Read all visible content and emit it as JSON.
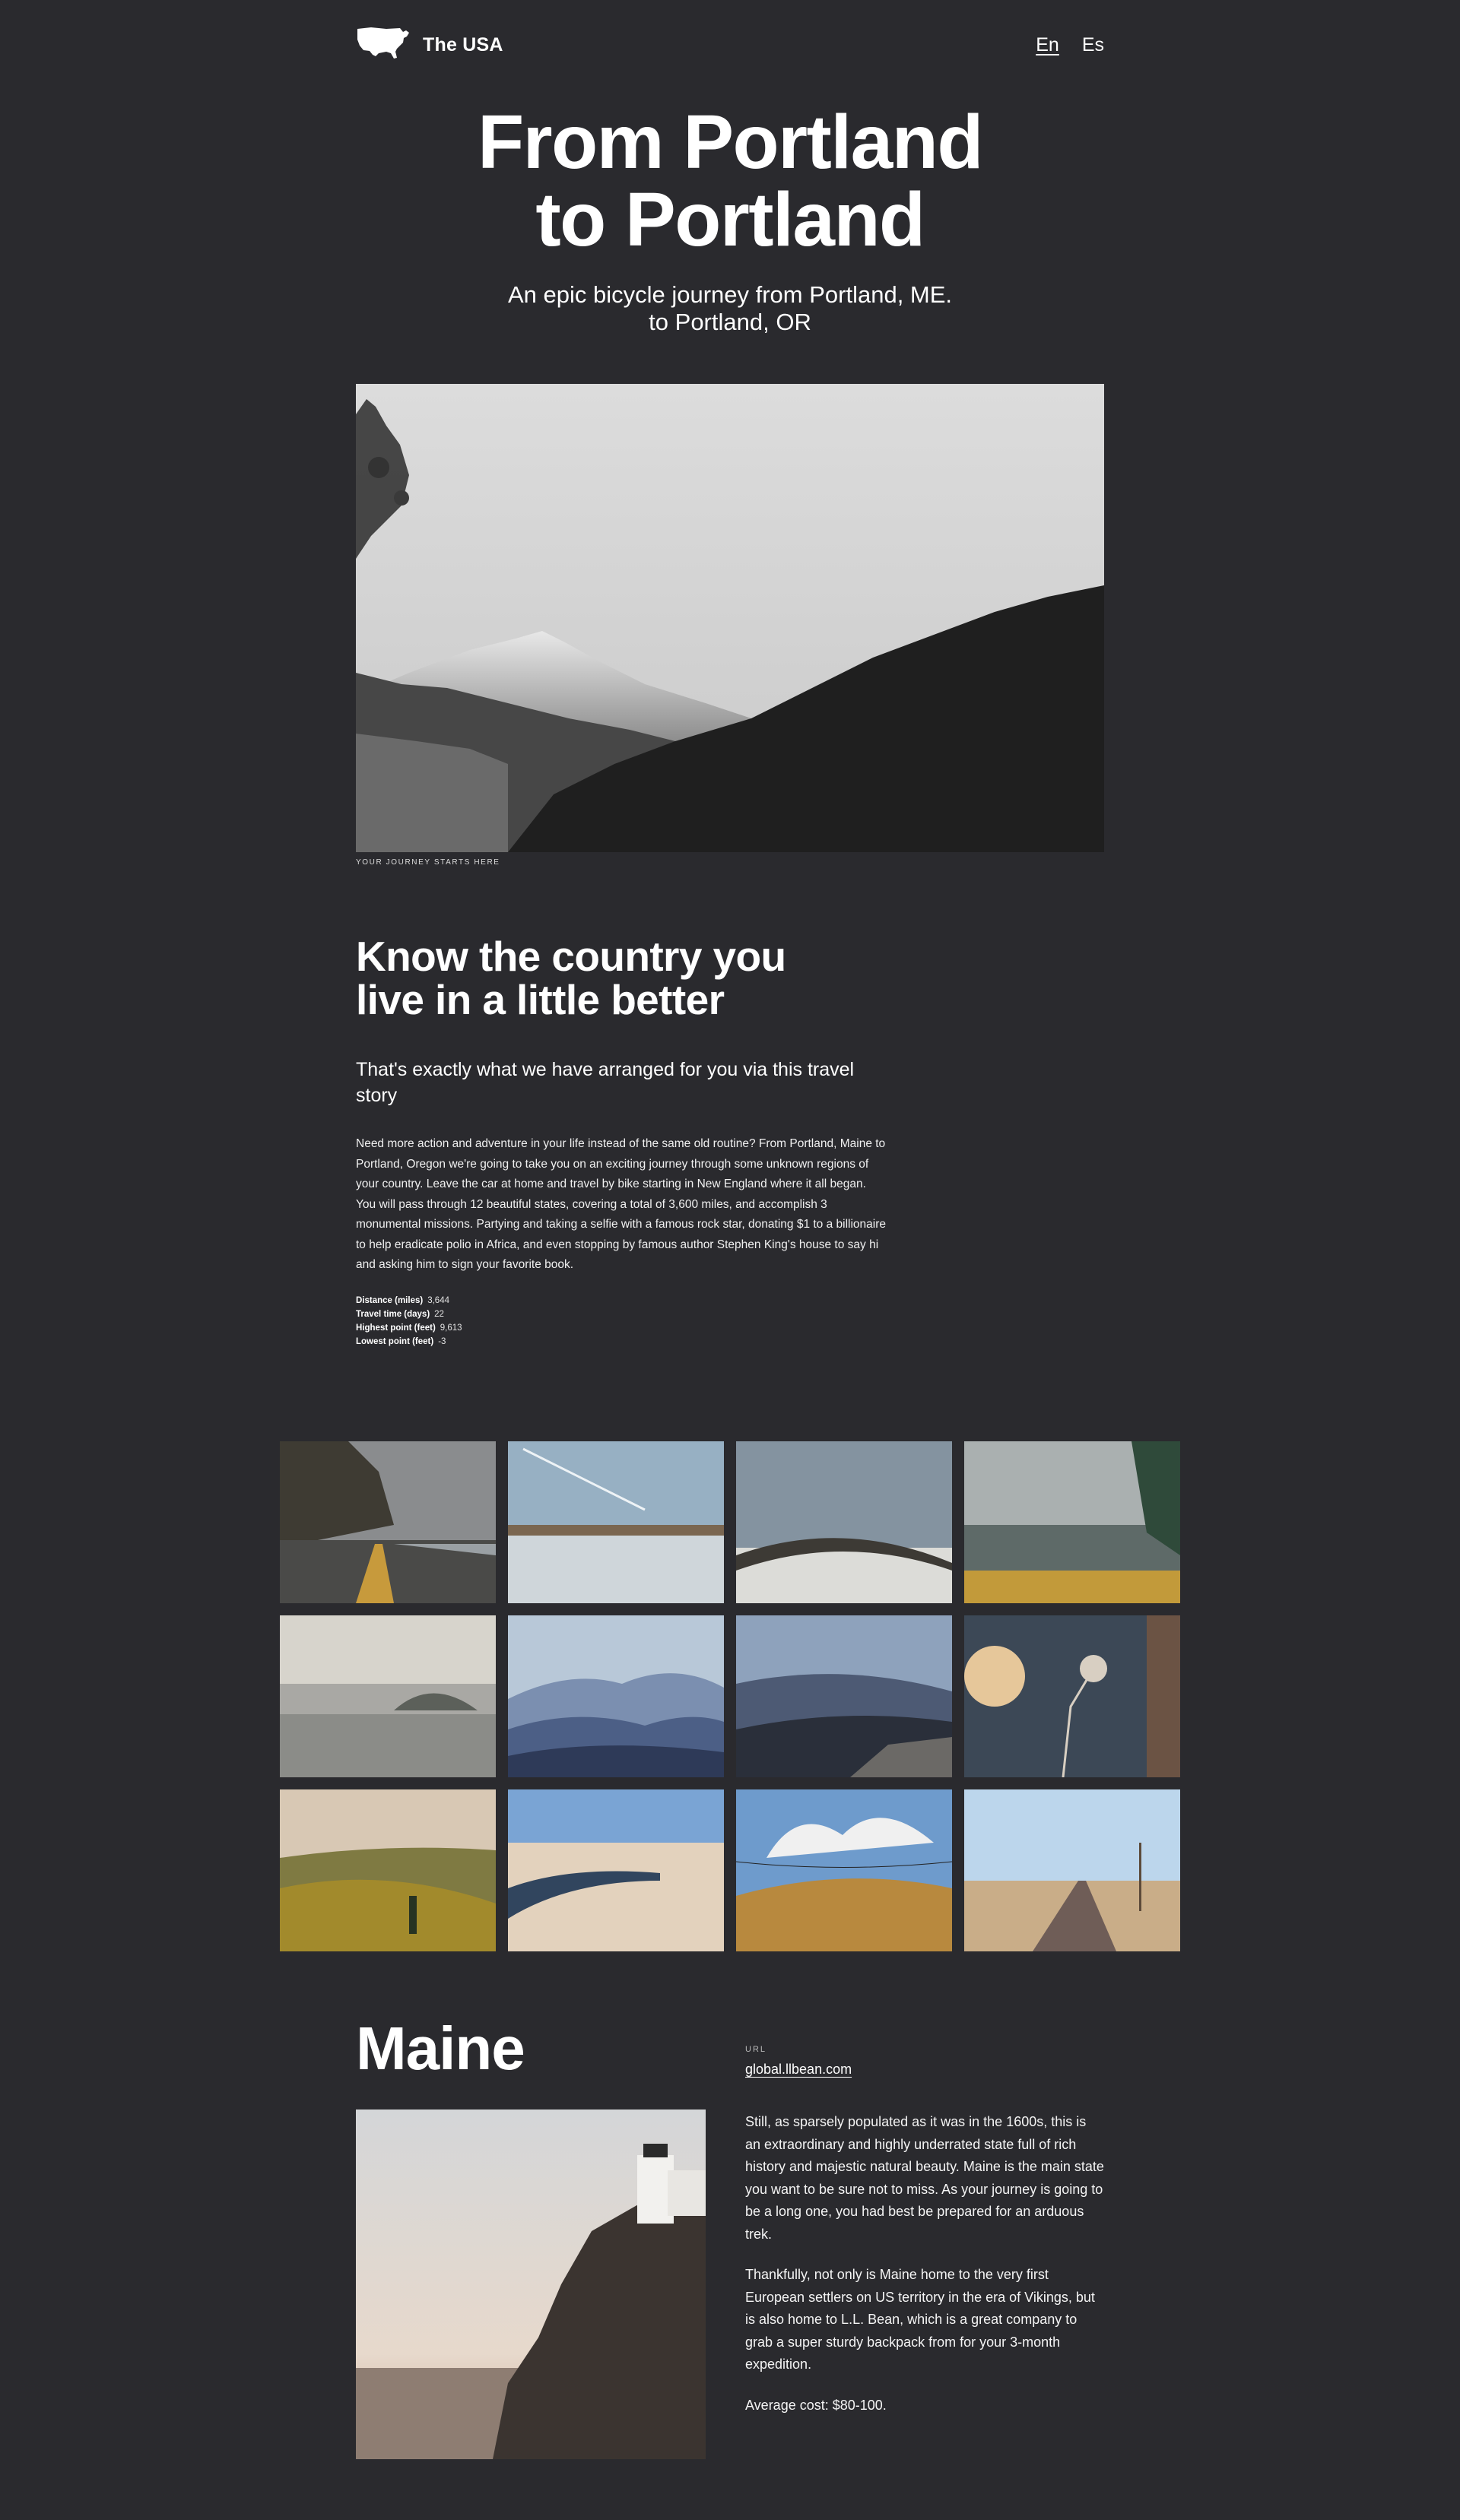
{
  "header": {
    "brand_name": "The USA",
    "logo_icon": "usa-map-icon",
    "languages": [
      {
        "label": "En",
        "active": true
      },
      {
        "label": "Es",
        "active": false
      }
    ]
  },
  "hero": {
    "title_line1": "From Portland",
    "title_line2": "to Portland",
    "subtitle_line1": "An epic bicycle journey from Portland, ME.",
    "subtitle_line2": "to Portland, OR",
    "image_caption": "Your journey starts here"
  },
  "intro": {
    "heading_line1": "Know the country you",
    "heading_line2": "live in a little better",
    "lead": "That's exactly what we have arranged for you via this travel story",
    "body": "Need more action and adventure in your life instead of the same old routine? From Portland, Maine to Portland, Oregon we're going to take you on an exciting journey through some unknown regions of your country. Leave the car at home and travel by bike starting in New England where it all began. You will pass through 12 beautiful states, covering a total of 3,600 miles, and accomplish 3 monumental missions. Partying and taking a selfie with a famous rock star, donating $1 to a billionaire to help eradicate polio in Africa, and even stopping by famous author Stephen King's house to say hi and asking him to sign your favorite book.",
    "stats": [
      {
        "label": "Distance (miles)",
        "value": "3,644"
      },
      {
        "label": "Travel time (days)",
        "value": "22"
      },
      {
        "label": "Highest point (feet)",
        "value": "9,613"
      },
      {
        "label": "Lowest point (feet)",
        "value": "-3"
      }
    ]
  },
  "gallery": {
    "photos": [
      "road-cliff-photo",
      "lake-sky-photo",
      "birds-field-photo",
      "misty-pines-photo",
      "foggy-lake-photo",
      "blue-mountains-photo",
      "ridge-rocks-photo",
      "dry-flowers-photo",
      "golden-hills-photo",
      "desert-river-photo",
      "birds-wire-photo",
      "desert-road-photo"
    ]
  },
  "maine": {
    "title": "Maine",
    "url_label": "URL",
    "url": "global.llbean.com",
    "paragraph1": "Still, as sparsely populated as it was in the 1600s, this is an extraordinary and highly underrated state full of rich history and majestic natural beauty. Maine is the main state you want to be sure not to miss. As your journey is going to be a long one, you had best be prepared for an arduous trek.",
    "paragraph2": "Thankfully, not only is Maine home to the very first European settlers on US territory in the era of Vikings, but is also home to L.L. Bean, which is a great company to grab a super sturdy backpack from for your 3-month expedition.",
    "average_cost": "Average cost: $80-100."
  }
}
